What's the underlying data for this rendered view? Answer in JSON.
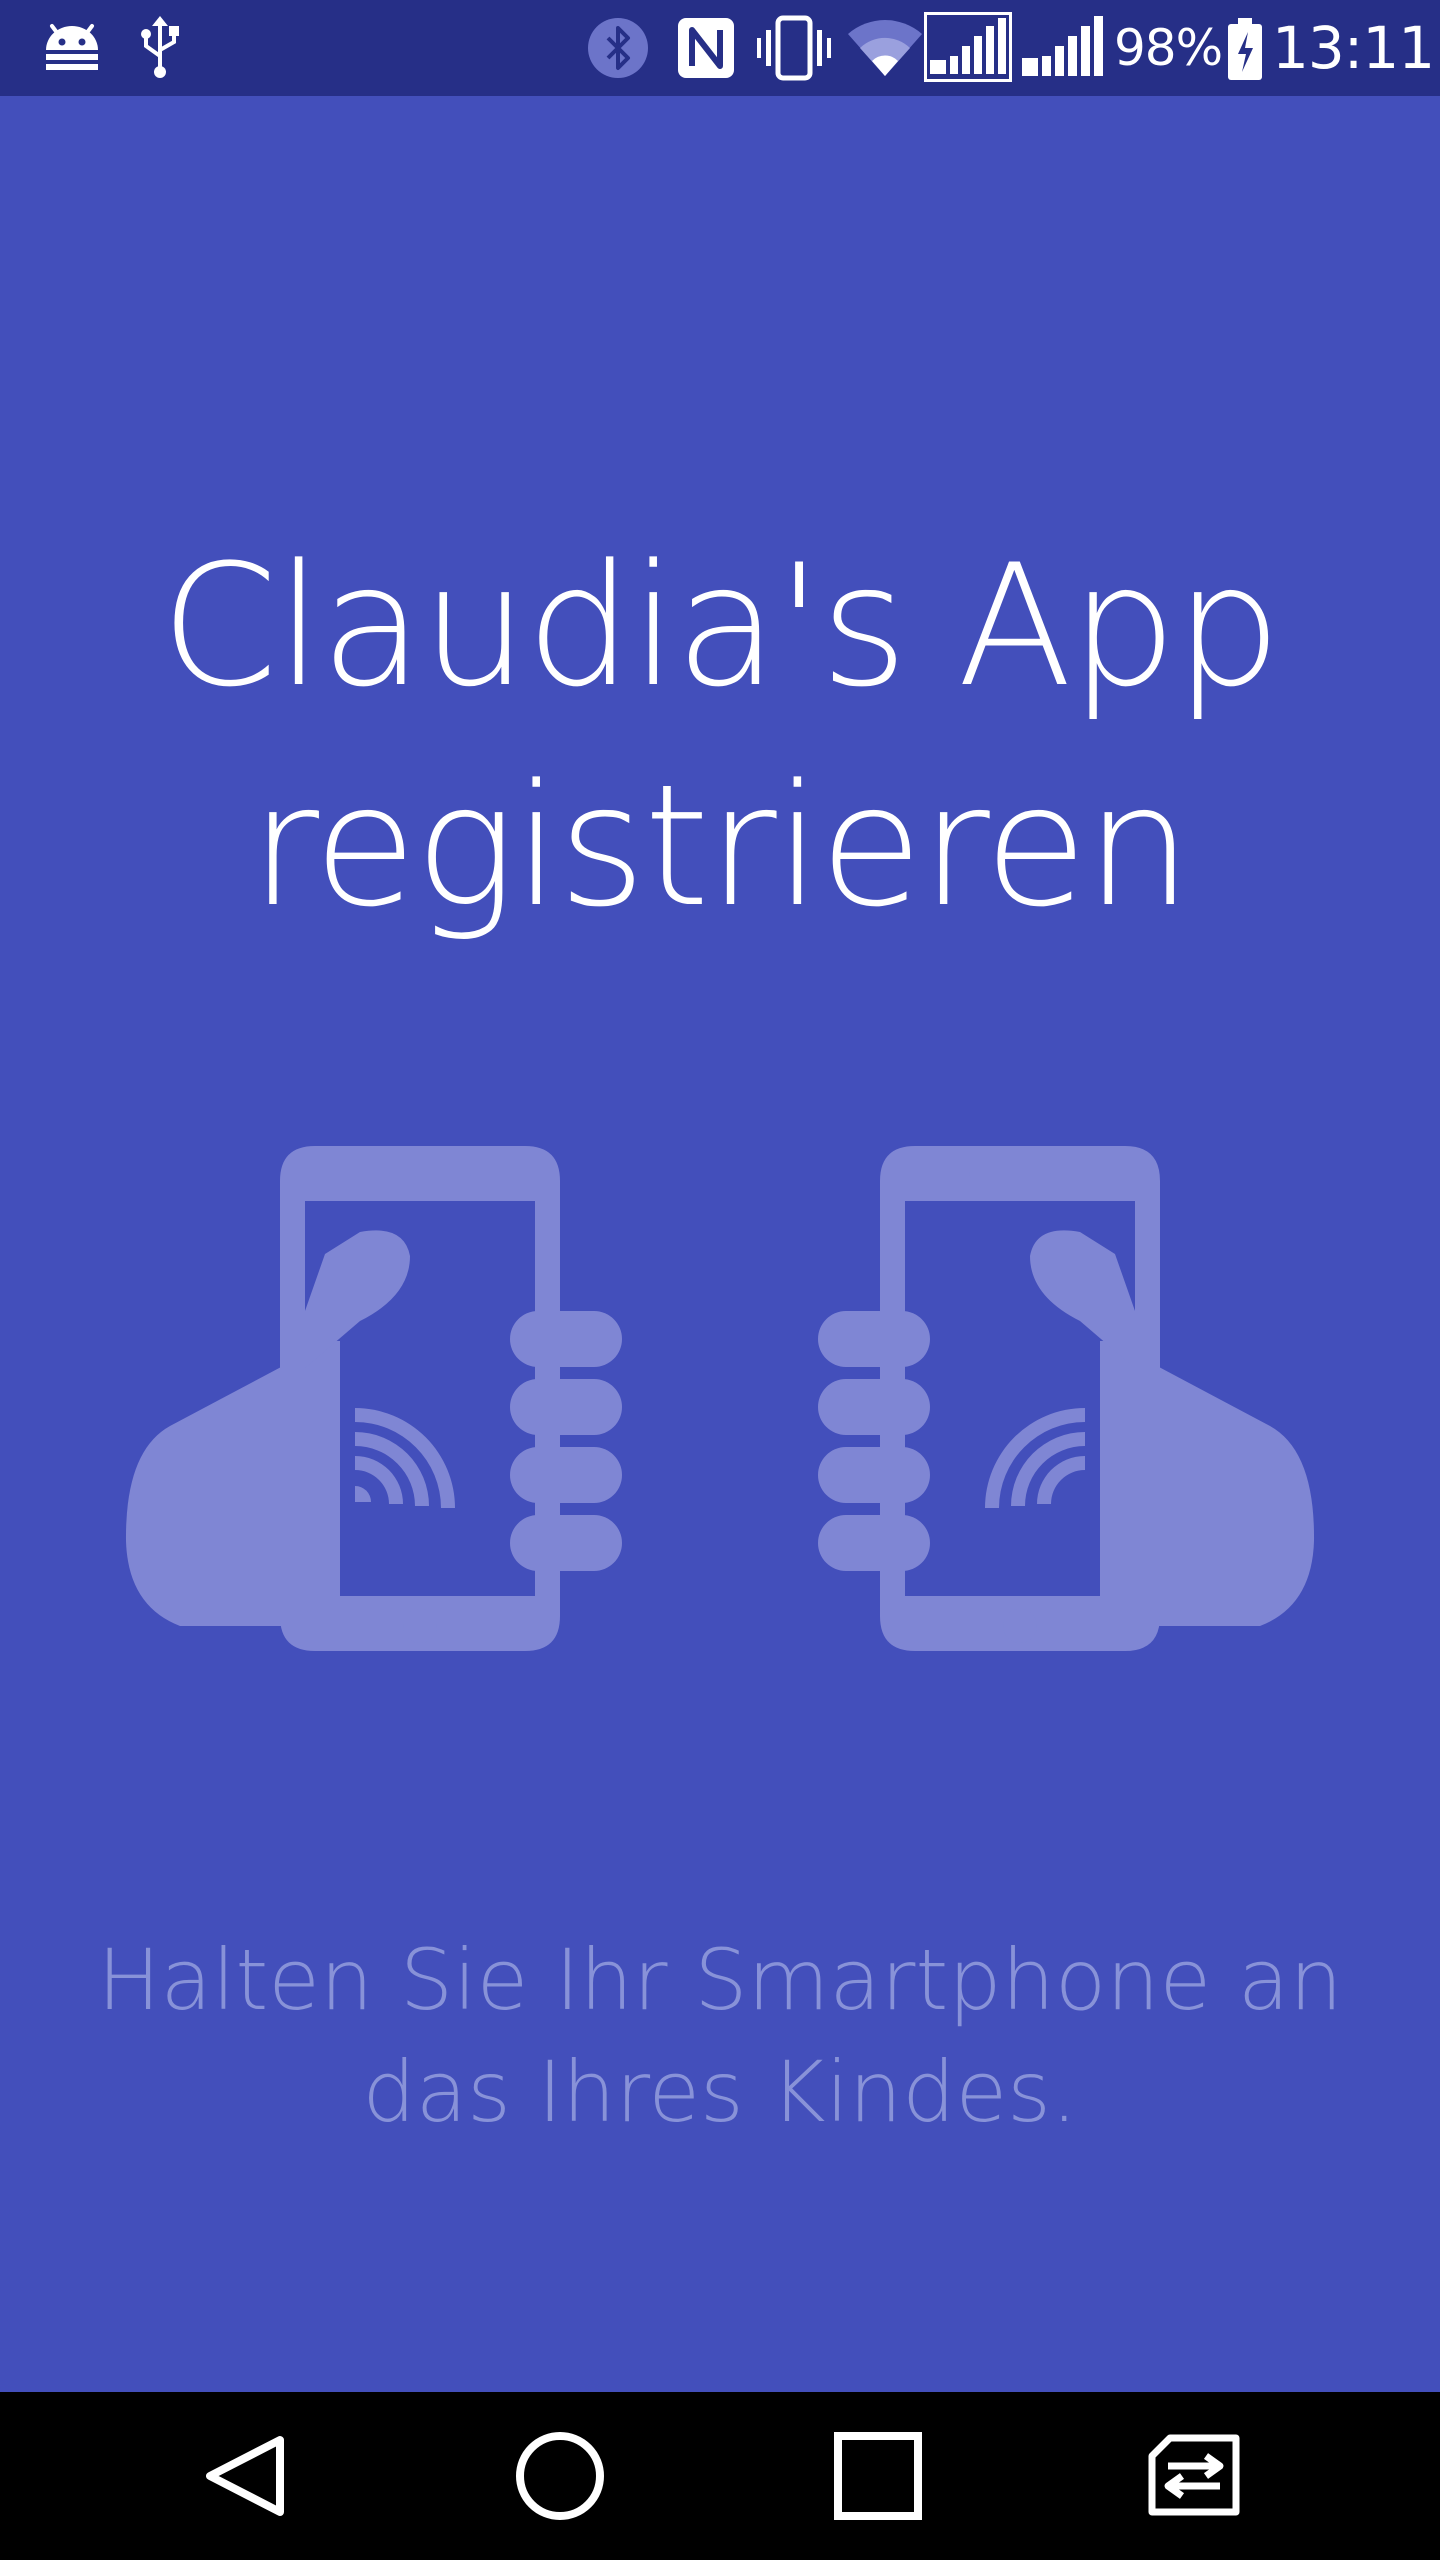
{
  "status_bar": {
    "battery_percent": "98%",
    "time": "13:11",
    "icons": [
      "android-debug-icon",
      "usb-icon",
      "bluetooth-icon",
      "nfc-icon",
      "vibrate-icon",
      "wifi-icon",
      "signal-sim1-icon",
      "signal-sim2-icon",
      "battery-charging-icon"
    ]
  },
  "main": {
    "title_line1": "Claudia's App",
    "title_line2": "registrieren",
    "illustration_icon": "phones-tap-nfc-icon",
    "instruction_line1": "Halten Sie Ihr Smartphone an",
    "instruction_line2": "das Ihres Kindes."
  },
  "nav_bar": {
    "buttons": [
      "back-icon",
      "home-icon",
      "recents-icon",
      "switch-sim-icon"
    ]
  },
  "colors": {
    "background": "#434fbb",
    "status_bar": "#262f87",
    "illustration": "#7f86d4",
    "instruction_text": "#8892d8",
    "nav_bar": "#000000"
  }
}
